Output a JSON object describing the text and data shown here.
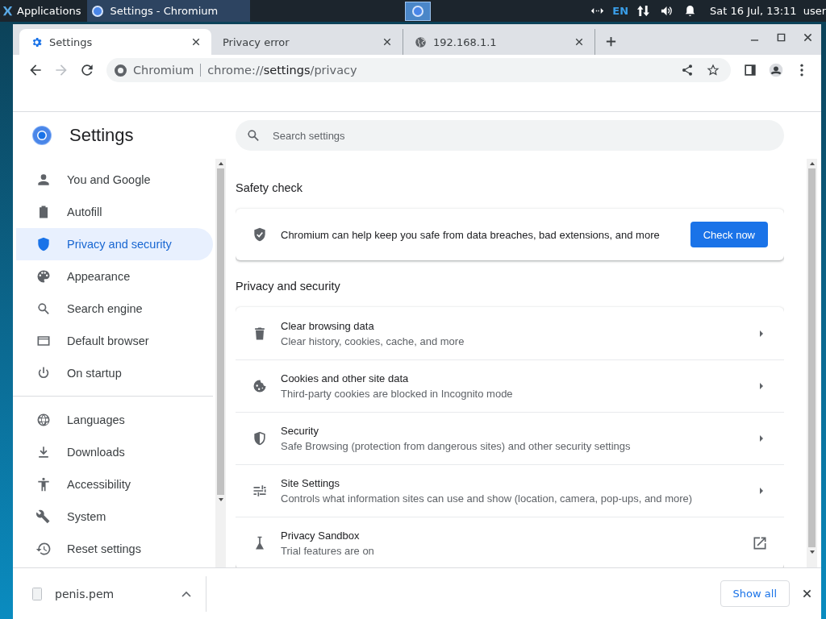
{
  "taskbar": {
    "apps_label": "Applications",
    "window_button": "Settings - Chromium",
    "keyboard_layout": "EN",
    "clock": "Sat 16 Jul, 13:11",
    "user": "user"
  },
  "tabs": [
    {
      "title": "Settings",
      "selected": true
    },
    {
      "title": "Privacy error",
      "selected": false
    },
    {
      "title": "192.168.1.1",
      "selected": false
    }
  ],
  "address_bar": {
    "origin": "Chromium",
    "url_scheme": "chrome://",
    "url_host": "settings",
    "url_path": "/privacy"
  },
  "sidebar": {
    "title": "Settings",
    "groups": [
      [
        {
          "label": "You and Google",
          "selected": false
        },
        {
          "label": "Autofill",
          "selected": false
        },
        {
          "label": "Privacy and security",
          "selected": true
        },
        {
          "label": "Appearance",
          "selected": false
        },
        {
          "label": "Search engine",
          "selected": false
        },
        {
          "label": "Default browser",
          "selected": false
        },
        {
          "label": "On startup",
          "selected": false
        }
      ],
      [
        {
          "label": "Languages",
          "selected": false
        },
        {
          "label": "Downloads",
          "selected": false
        },
        {
          "label": "Accessibility",
          "selected": false
        },
        {
          "label": "System",
          "selected": false
        },
        {
          "label": "Reset settings",
          "selected": false
        }
      ]
    ]
  },
  "search": {
    "placeholder": "Search settings"
  },
  "safety_check": {
    "heading": "Safety check",
    "text": "Chromium can help keep you safe from data breaches, bad extensions, and more",
    "button": "Check now"
  },
  "privacy": {
    "heading": "Privacy and security",
    "rows": [
      {
        "title": "Clear browsing data",
        "subtitle": "Clear history, cookies, cache, and more",
        "kind": "arrow"
      },
      {
        "title": "Cookies and other site data",
        "subtitle": "Third-party cookies are blocked in Incognito mode",
        "kind": "arrow"
      },
      {
        "title": "Security",
        "subtitle": "Safe Browsing (protection from dangerous sites) and other security settings",
        "kind": "arrow"
      },
      {
        "title": "Site Settings",
        "subtitle": "Controls what information sites can use and show (location, camera, pop-ups, and more)",
        "kind": "arrow"
      },
      {
        "title": "Privacy Sandbox",
        "subtitle": "Trial features are on",
        "kind": "external"
      }
    ]
  },
  "download_bar": {
    "file": "penis.pem",
    "button": "Show all"
  }
}
